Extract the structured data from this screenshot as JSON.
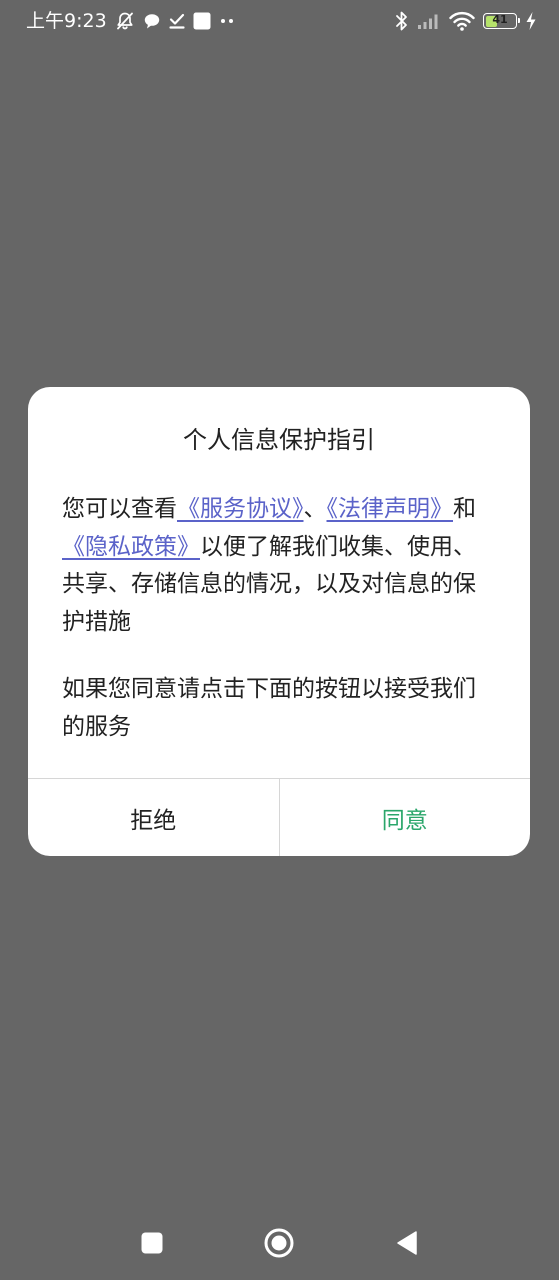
{
  "status_bar": {
    "time": "上午9:23",
    "battery_level": "41",
    "battery_fraction": 0.41,
    "icons": [
      "mute-icon",
      "chat-bubble-icon",
      "download-done-icon",
      "square-notification-icon",
      "more-dots-icon",
      "bluetooth-icon",
      "signal-icon",
      "wifi-icon",
      "battery-icon",
      "charging-icon"
    ]
  },
  "dialog": {
    "title": "个人信息保护指引",
    "paragraph1": {
      "prefix": "您可以查看",
      "link_service": "《服务协议》",
      "sep1": "、",
      "link_legal": "《法律声明》",
      "sep2": "和",
      "link_privacy": "《隐私政策》",
      "suffix": "以便了解我们收集、使用、共享、存储信息的情况，以及对信息的保护措施"
    },
    "paragraph2": "如果您同意请点击下面的按钮以接受我们的服务",
    "reject_label": "拒绝",
    "agree_label": "同意"
  },
  "colors": {
    "overlay": "#666666",
    "link": "#5b63c9",
    "agree": "#2aa66a",
    "text": "#222222",
    "battery_fill": "#b6e36b"
  },
  "nav_bar": {
    "icons": [
      "recent-apps-icon",
      "home-icon",
      "back-icon"
    ]
  }
}
